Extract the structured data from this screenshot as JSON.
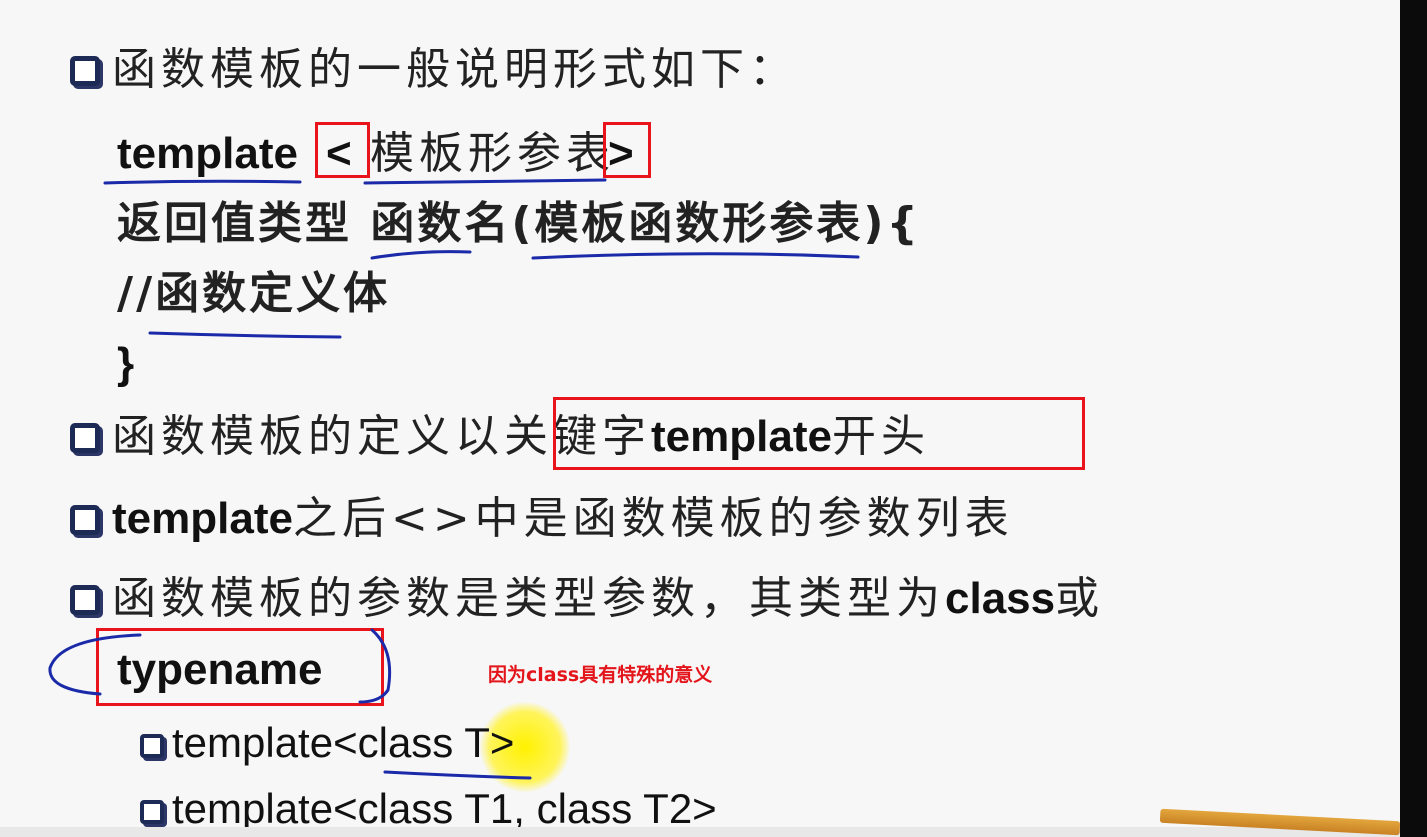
{
  "lines": {
    "l1": "函数模板的一般说明形式如下：",
    "l2_kw": "template",
    "l2_lt": "<",
    "l2_params": "模板形参表",
    "l2_gt": ">",
    "l3": "返回值类型 函数名(模板函数形参表){",
    "l4": "//函数定义体",
    "l5": "}",
    "l6_a": "函数模板的定义以",
    "l6_b": "关键字",
    "l6_kw": "template",
    "l6_c": "开头",
    "l7_kw": "template",
    "l7_rest": "之后<>中是函数模板的参数列表",
    "l8": "函数模板的参数是类型参数，其类型为",
    "l8_kw": "class",
    "l8_end": "或",
    "l9": "typename",
    "l10": "template<class T>",
    "l11": "template<class T1, class T2>"
  },
  "note": "因为class具有特殊的意义",
  "colors": {
    "highlight_box": "#e8131b",
    "ink": "#1a2aa8",
    "bullet": "#1d2a55",
    "cursor": "#fff200"
  }
}
